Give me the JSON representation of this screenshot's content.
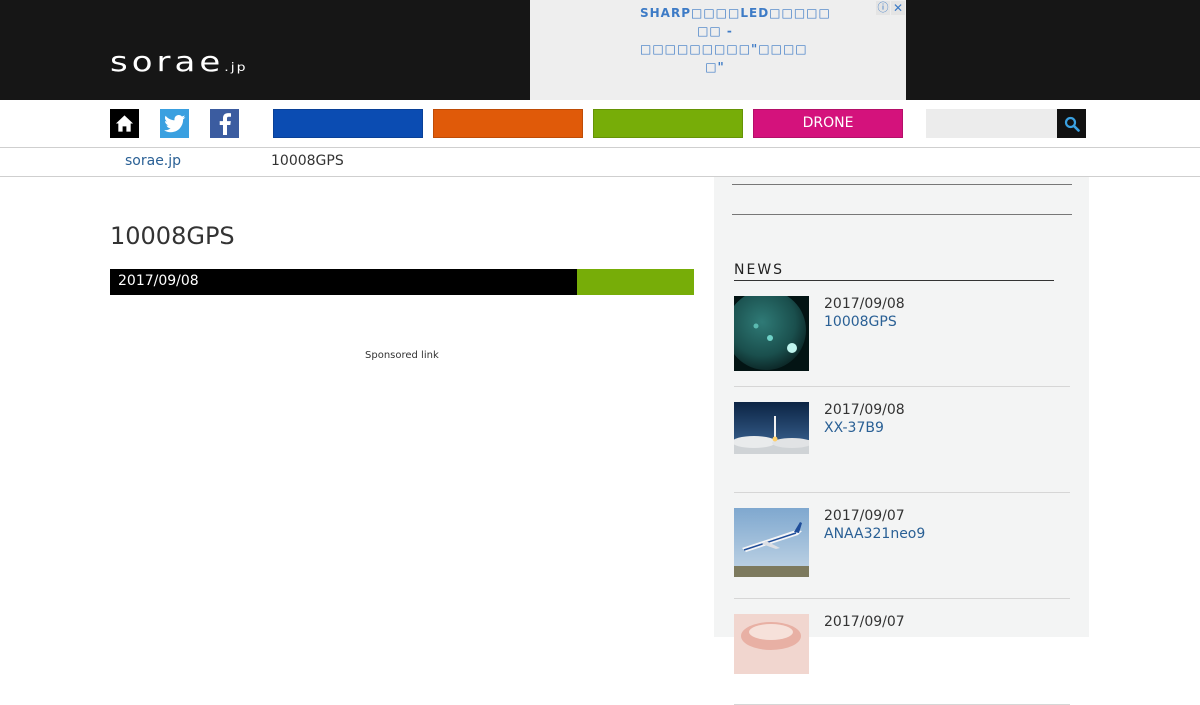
{
  "header": {
    "logo_main": "sorae",
    "logo_suffix": ".jp",
    "ad": {
      "text": "SHARP□□□□LED□□□□□ □□ - □□□□□□□□□\"□□□□ □\"",
      "info_icon": "ⓘ",
      "close_icon": "✕"
    }
  },
  "nav": {
    "icons": [
      "home-icon",
      "twitter-icon",
      "facebook-icon",
      "search-icon"
    ],
    "categories": [
      {
        "label": "",
        "color": "#0b4cb2"
      },
      {
        "label": "",
        "color": "#e05a09"
      },
      {
        "label": "",
        "color": "#77ad08"
      },
      {
        "label": "DRONE",
        "color": "#d4127c"
      }
    ],
    "search_placeholder": ""
  },
  "breadcrumb": {
    "home": "sorae.jp",
    "current": "10008GPS"
  },
  "article": {
    "title": "10008GPS",
    "date": "2017/09/08",
    "category_color": "#77ad08",
    "sponsored": "Sponsored link"
  },
  "sidebar": {
    "news_heading": "NEWS",
    "news": [
      {
        "date": "2017/09/08",
        "title": "10008GPS",
        "thumb": "sun-image"
      },
      {
        "date": "2017/09/08",
        "title": "XX-37B9",
        "thumb": "rocket-launch-image"
      },
      {
        "date": "2017/09/07",
        "title": "ANAA321neo9",
        "thumb": "airplane-image"
      },
      {
        "date": "2017/09/07",
        "title": "",
        "thumb": "food-image"
      }
    ]
  }
}
